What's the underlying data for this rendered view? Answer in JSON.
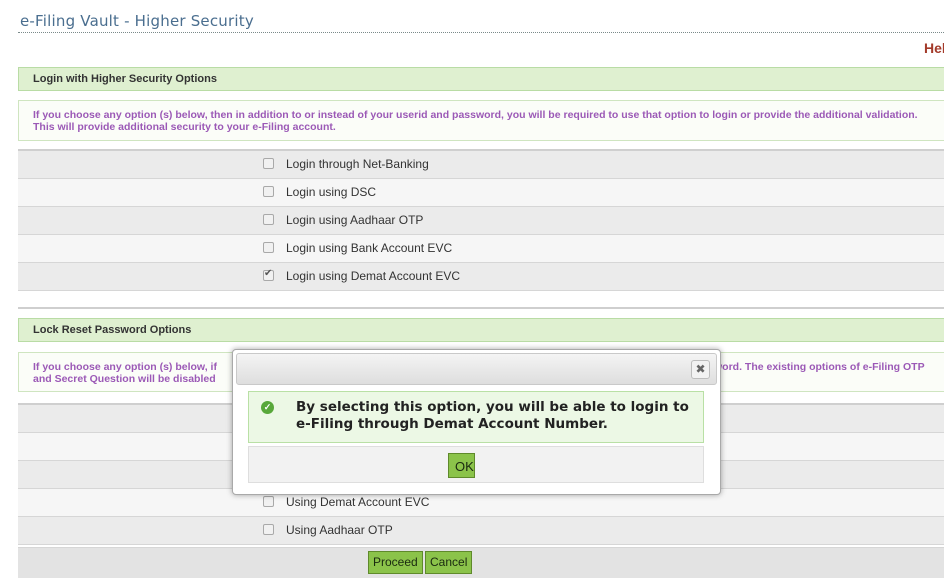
{
  "page": {
    "title": "e-Filing Vault - Higher Security",
    "help_label": "Help"
  },
  "login_section": {
    "header": "Login with Higher Security Options",
    "info": "If you choose any option (s) below, then in addition to or instead of your userid and password, you will be required to use that option to login or provide the additional validation. This will provide additional security to your e-Filing account.",
    "options": [
      {
        "label": "Login through Net-Banking",
        "checked": false
      },
      {
        "label": "Login using DSC",
        "checked": false
      },
      {
        "label": "Login using Aadhaar OTP",
        "checked": false
      },
      {
        "label": "Login using Bank Account EVC",
        "checked": false
      },
      {
        "label": "Login using Demat Account EVC",
        "checked": true
      }
    ]
  },
  "lock_section": {
    "header": "Lock Reset Password Options",
    "info_left": "If you choose any option (s) below, if",
    "info_left_2": "and Secret Question will be disabled",
    "info_right": "word. The existing options of e-Filing OTP",
    "options": [
      {
        "label": "",
        "checked": false
      },
      {
        "label": "",
        "checked": false
      },
      {
        "label": "",
        "checked": false
      },
      {
        "label": "Using Demat Account EVC",
        "checked": false
      },
      {
        "label": "Using Aadhaar OTP",
        "checked": false
      }
    ]
  },
  "buttons": {
    "proceed": "Proceed",
    "cancel": "Cancel"
  },
  "modal": {
    "close_glyph": "✖",
    "message": "By selecting this option, you will be able to login to e-Filing through Demat Account Number.",
    "ok_label": "OK"
  },
  "colors": {
    "title": "#4a6e8f",
    "help": "#a33a2a",
    "section_header_bg": "#dff0d0",
    "info_text": "#9b59b6",
    "button_green": "#8bc34a"
  }
}
